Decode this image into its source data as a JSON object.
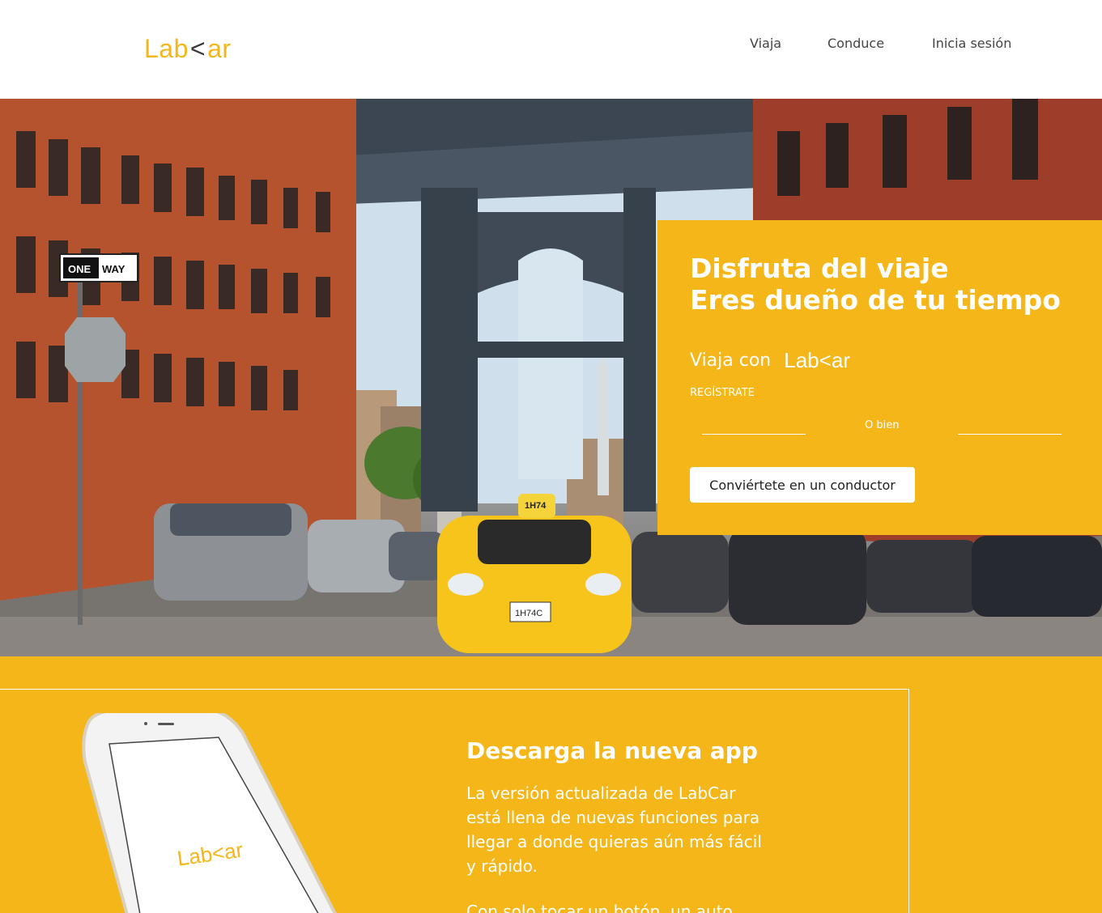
{
  "header": {
    "logo_left": "Lab",
    "logo_chevron": "<",
    "logo_right": "ar",
    "nav": [
      "Viaja",
      "Conduce",
      "Inicia sesión"
    ]
  },
  "hero": {
    "title_line1": "Disfruta del viaje",
    "title_line2": "Eres dueño de tu tiempo",
    "viaja_con": "Viaja con",
    "mini_logo": "Lab<ar",
    "register": "REGÍSTRATE",
    "or": "O bien",
    "driver_button": "Conviértete en un conductor",
    "sign_one_way_left": "ONE",
    "sign_one_way_right": "WAY",
    "taxi_plate": "1H74C",
    "taxi_roof": "1H74"
  },
  "app": {
    "title": "Descarga la nueva app",
    "description": "La versión actualizada de LabCar está llena de nuevas funciones para llegar a donde quieras aún más fácil y rápido.",
    "description2": "Con solo tocar un botón, un auto",
    "phone_logo": "Lab<ar"
  },
  "colors": {
    "brand_yellow": "#f5b619",
    "logo_dark": "#3a3a3a"
  }
}
